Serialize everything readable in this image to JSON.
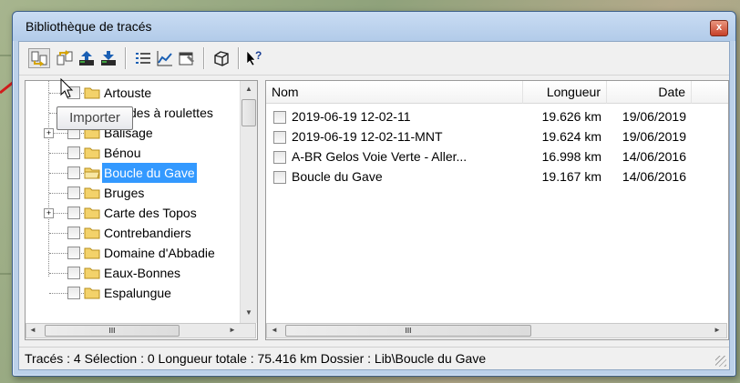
{
  "window": {
    "title": "Bibliothèque de tracés",
    "close_glyph": "x"
  },
  "toolbar": {
    "buttons": [
      {
        "name": "import-icon",
        "tooltip": "Importer"
      },
      {
        "name": "export-icon"
      },
      {
        "name": "upload-icon"
      },
      {
        "name": "download-icon"
      },
      {
        "name": "list-icon"
      },
      {
        "name": "profile-chart-icon"
      },
      {
        "name": "properties-icon"
      },
      {
        "name": "3d-view-icon"
      },
      {
        "name": "help-icon"
      }
    ]
  },
  "tooltip": "Importer",
  "tree": {
    "items": [
      {
        "label": "Artouste",
        "expander": false,
        "selected": false
      },
      {
        "label": "Balades à roulettes",
        "expander": false,
        "selected": false
      },
      {
        "label": "Balisage",
        "expander": true,
        "selected": false
      },
      {
        "label": "Bénou",
        "expander": false,
        "selected": false
      },
      {
        "label": "Boucle du Gave",
        "expander": false,
        "selected": true
      },
      {
        "label": "Bruges",
        "expander": false,
        "selected": false
      },
      {
        "label": "Carte des Topos",
        "expander": true,
        "selected": false
      },
      {
        "label": "Contrebandiers",
        "expander": false,
        "selected": false
      },
      {
        "label": "Domaine d'Abbadie",
        "expander": false,
        "selected": false
      },
      {
        "label": "Eaux-Bonnes",
        "expander": false,
        "selected": false
      },
      {
        "label": "Espalungue",
        "expander": false,
        "selected": false
      }
    ]
  },
  "list": {
    "columns": [
      "Nom",
      "Longueur",
      "Date"
    ],
    "rows": [
      {
        "name": "2019-06-19 12-02-11",
        "length": "19.626 km",
        "date": "19/06/2019"
      },
      {
        "name": "2019-06-19 12-02-11-MNT",
        "length": "19.624 km",
        "date": "19/06/2019"
      },
      {
        "name": "A-BR Gelos Voie Verte - Aller...",
        "length": "16.998 km",
        "date": "14/06/2016"
      },
      {
        "name": "Boucle du Gave",
        "length": "19.167 km",
        "date": "14/06/2016"
      }
    ]
  },
  "scroll": {
    "arrow_up": "▲",
    "arrow_down": "▼",
    "arrow_left": "◄",
    "arrow_right": "►",
    "grip": "III"
  },
  "status": {
    "text": "Tracés : 4 Sélection : 0 Longueur totale : 75.416 km Dossier : Lib\\Boucle du Gave"
  },
  "colors": {
    "selection": "#3399ff",
    "title_bar": "#b9cfea",
    "annotation_arrow": "#d21c1c"
  }
}
